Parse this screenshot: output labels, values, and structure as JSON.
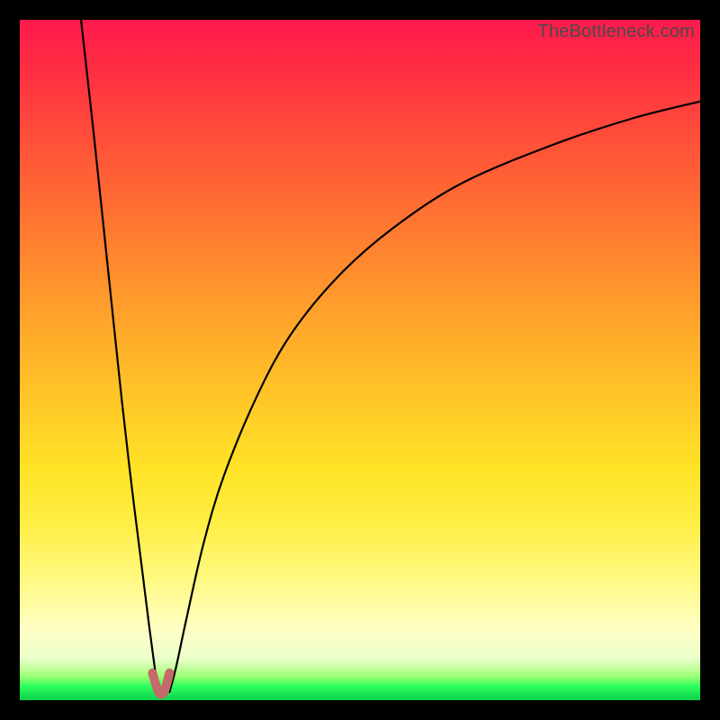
{
  "attribution": "TheBottleneck.com",
  "colors": {
    "frame": "#000000",
    "curve_stroke": "#000000",
    "dip_marker": "#c46a6a",
    "gradient_top": "#ff1a4d",
    "gradient_bottom": "#0bd24d"
  },
  "chart_data": {
    "type": "line",
    "title": "",
    "xlabel": "",
    "ylabel": "",
    "xlim": [
      0,
      100
    ],
    "ylim": [
      0,
      100
    ],
    "grid": false,
    "notes": "Bottleneck-style curve: two branches plunging to a minimum near x≈20; left branch rises to y=100 near x≈9, right branch rises asymptotically to y≈88 at x=100. Background is a vertical red→green gradient (red=high/bad, green=low/good).",
    "series": [
      {
        "name": "left-branch",
        "x": [
          9.0,
          11.0,
          13.0,
          15.0,
          16.5,
          18.0,
          19.0,
          19.8,
          20.4
        ],
        "y": [
          100,
          82,
          63,
          44,
          31,
          19,
          11,
          5.0,
          1.2
        ]
      },
      {
        "name": "right-branch",
        "x": [
          22.0,
          23.0,
          24.5,
          27.0,
          30.0,
          35.0,
          40.0,
          47.0,
          55.0,
          65.0,
          78.0,
          90.0,
          100.0
        ],
        "y": [
          1.2,
          5.0,
          12.0,
          23.0,
          33.0,
          45.0,
          54.0,
          62.5,
          69.5,
          76.0,
          81.5,
          85.5,
          88.0
        ]
      },
      {
        "name": "dip-marker",
        "x": [
          19.5,
          20.4,
          21.2,
          22.0
        ],
        "y": [
          4.0,
          1.2,
          1.2,
          4.0
        ]
      }
    ],
    "minimum": {
      "x": 21.0,
      "y": 1.2
    }
  }
}
